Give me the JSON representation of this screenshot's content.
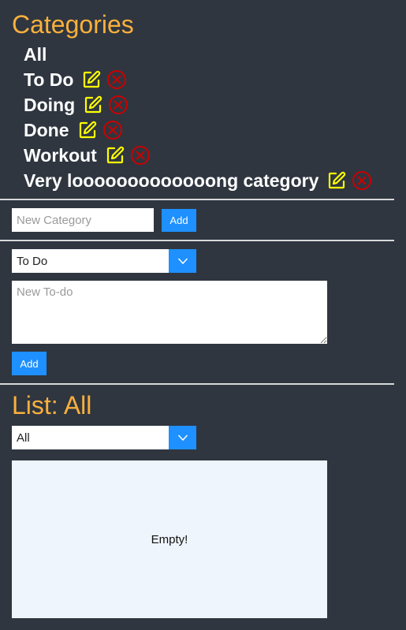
{
  "categories": {
    "title": "Categories",
    "items": [
      {
        "label": "All",
        "editable": false
      },
      {
        "label": "To Do",
        "editable": true
      },
      {
        "label": "Doing",
        "editable": true
      },
      {
        "label": "Done",
        "editable": true
      },
      {
        "label": "Workout",
        "editable": true
      },
      {
        "label": "Very looooooooooooong category",
        "editable": true
      }
    ],
    "edit_icon": "edit-icon",
    "delete_icon": "delete-circle-x-icon"
  },
  "new_category": {
    "placeholder": "New Category",
    "add_label": "Add"
  },
  "new_todo": {
    "category_selected": "To Do",
    "placeholder": "New To-do",
    "add_label": "Add"
  },
  "list": {
    "title": "List: All",
    "filter_selected": "All",
    "empty_text": "Empty!"
  },
  "colors": {
    "background": "#2f3640",
    "heading": "#fbb03b",
    "accent": "#1e90ff",
    "edit_icon": "#ffff00",
    "delete_icon": "#cc0000"
  }
}
